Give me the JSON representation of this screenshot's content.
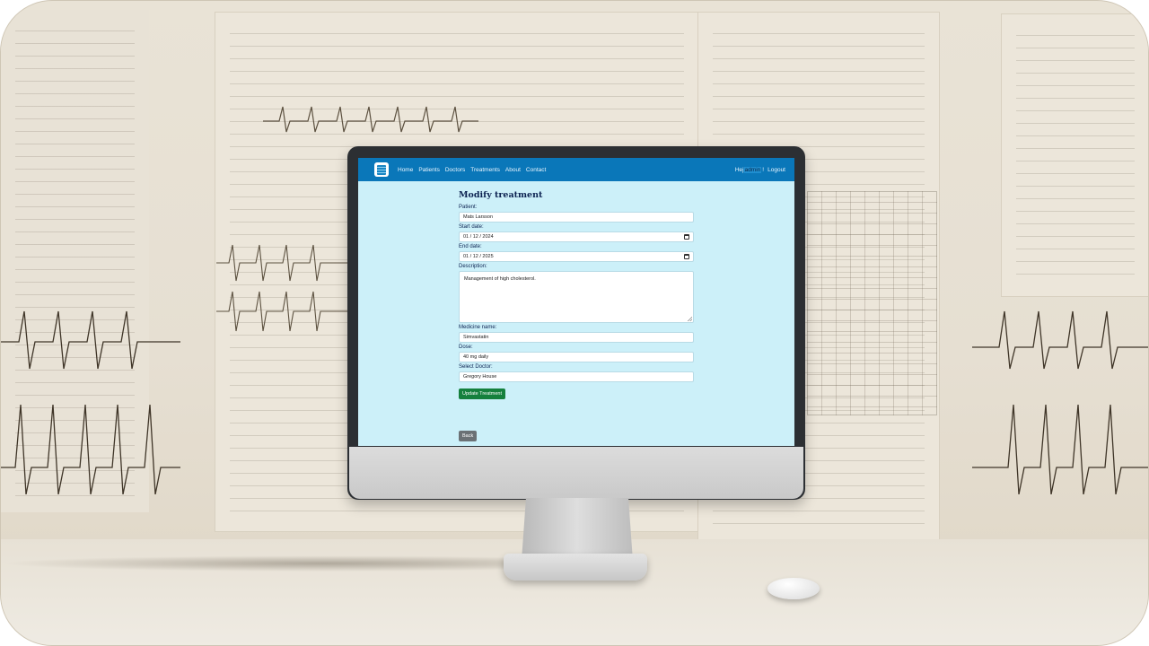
{
  "nav": {
    "links": [
      "Home",
      "Patients",
      "Doctors",
      "Treatments",
      "About",
      "Contact"
    ],
    "greeting": "Hej",
    "username": "admin",
    "greeting_end": "!",
    "logout": "Logout"
  },
  "form": {
    "title": "Modify treatment",
    "patient_label": "Patient:",
    "patient_value": "Mats Larsson",
    "start_label": "Start date:",
    "start_value": "01 / 12 / 2024",
    "end_label": "End date:",
    "end_value": "01 / 12 / 2025",
    "description_label": "Description:",
    "description_value": "Management of high cholesterol.",
    "medicine_label": "Medicine name:",
    "medicine_value": "Simvastatin",
    "dose_label": "Dose:",
    "dose_value": "40 mg daily",
    "doctor_label": "Select Doctor:",
    "doctor_value": "Gregory House",
    "submit_label": "Update Treatment",
    "back_label": "Back"
  },
  "icons": {
    "logo": "clinic-logo-icon",
    "calendar": "calendar-icon"
  },
  "colors": {
    "navbar": "#0a77b9",
    "screen_background": "#ccf0f9",
    "submit_button": "#15803d",
    "back_button": "#6b7175"
  }
}
